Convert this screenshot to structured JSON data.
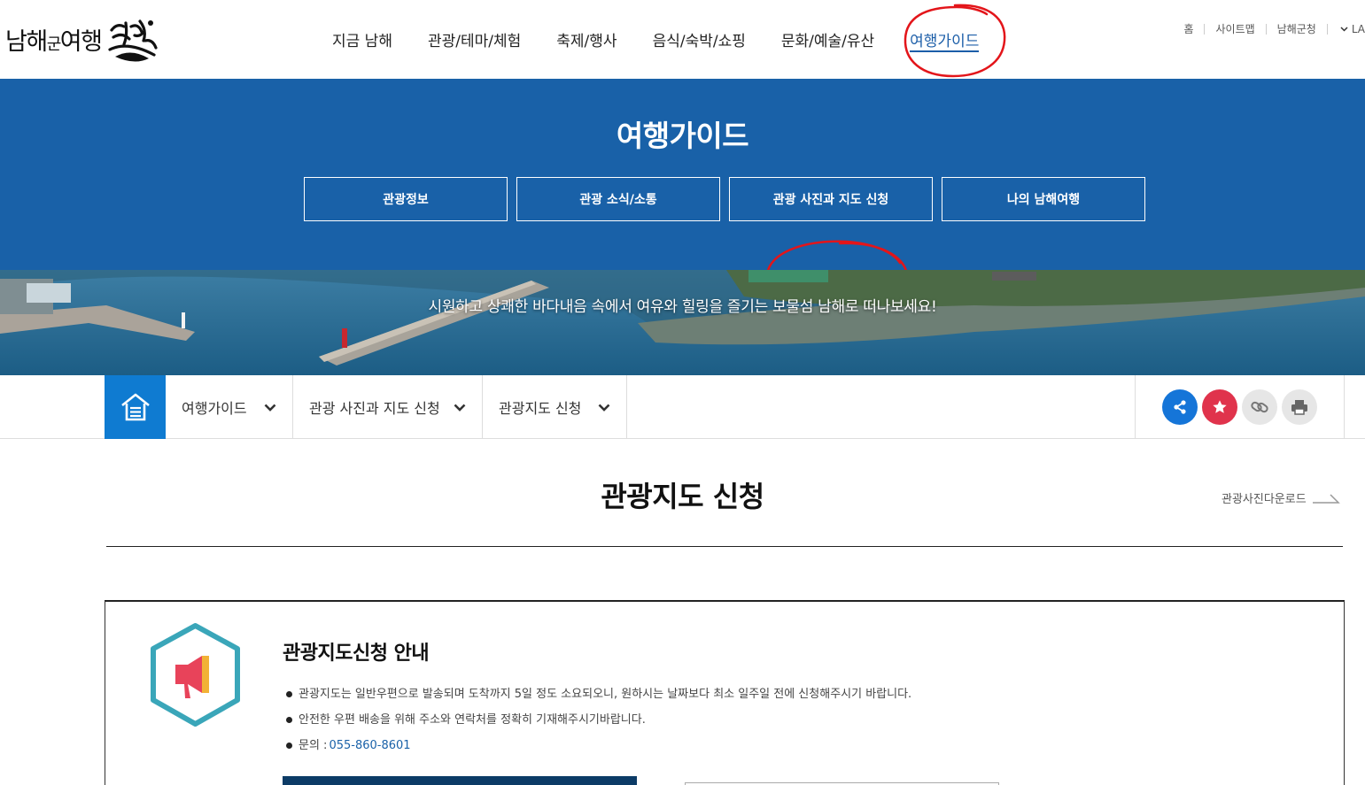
{
  "header": {
    "logo_main": "남해",
    "logo_small": "군",
    "logo_tail": "여행",
    "gnb": [
      {
        "label": "지금 남해",
        "active": false
      },
      {
        "label": "관광/테마/체험",
        "active": false
      },
      {
        "label": "축제/행사",
        "active": false
      },
      {
        "label": "음식/숙박/쇼핑",
        "active": false
      },
      {
        "label": "문화/예술/유산",
        "active": false
      },
      {
        "label": "여행가이드",
        "active": true
      }
    ],
    "util": [
      "홈",
      "사이트맵",
      "남해군청"
    ],
    "lang": "LA"
  },
  "banner": {
    "title": "여행가이드",
    "subnav": [
      "관광정보",
      "관광 소식/소통",
      "관광 사진과 지도 신청",
      "나의 남해여행"
    ]
  },
  "photo": {
    "caption": "시원하고 상쾌한 바다내음 속에서 여유와 힐링을 즐기는 보물섬 남해로 떠나보세요!"
  },
  "location": {
    "crumbs": [
      "여행가이드",
      "관광 사진과 지도 신청",
      "관광지도 신청"
    ],
    "tools": [
      {
        "icon": "share-icon",
        "color": "#1575d8"
      },
      {
        "icon": "star-icon",
        "color": "#e0334c"
      },
      {
        "icon": "link-icon",
        "color": "#e6e6e6"
      },
      {
        "icon": "print-icon",
        "color": "#e6e6e6"
      }
    ]
  },
  "content": {
    "title": "관광지도 신청",
    "download_link": "관광사진다운로드",
    "info_title": "관광지도신청 안내",
    "info_items": [
      "관광지도는 일반우편으로 발송되며 도착까지 5일 정도 소요되오니, 원하시는 날짜보다 최소 일주일 전에 신청해주시기 바랍니다.",
      "안전한 우편 배송을 위해 주소와 연락처를 정확히 기재해주시기바랍니다."
    ],
    "contact_label": "문의 : ",
    "contact_phone": "055-860-8601"
  },
  "colors": {
    "brand_blue": "#1961a8",
    "home_blue": "#0f7bd1",
    "active_nav": "#1c5ea8",
    "hex_border": "#3aa6b9",
    "megaphone": "#e8435a",
    "annotation_red": "#e3151a"
  }
}
